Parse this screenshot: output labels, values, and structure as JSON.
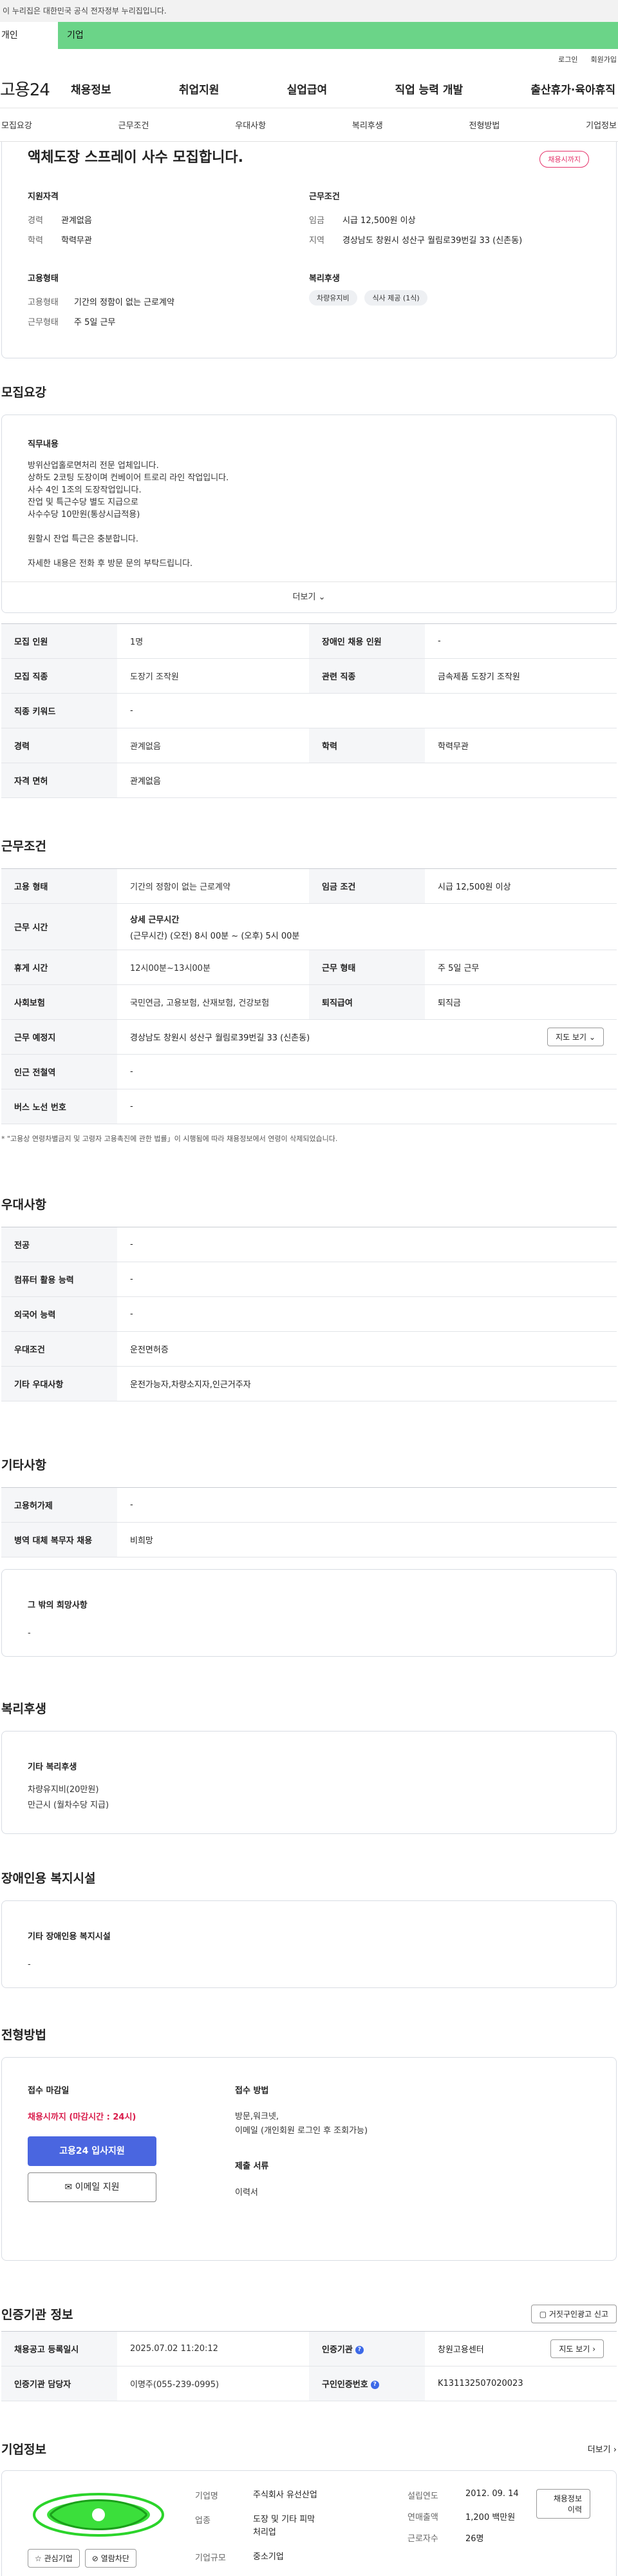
{
  "top": {
    "gov_banner": "이 누리집은 대한민국 공식 전자정부 누리집입니다.",
    "tab_personal": "개인",
    "tab_corporate": "기업"
  },
  "util": {
    "login": "로그인",
    "signup": "회원가입"
  },
  "gnb": {
    "logo": "고용24",
    "menu": [
      "채용정보",
      "취업지원",
      "실업급여",
      "직업 능력 개발",
      "출산휴가·육아휴직"
    ]
  },
  "anchor_nav": [
    "모집요강",
    "근무조건",
    "우대사항",
    "복리후생",
    "전형방법",
    "기업정보"
  ],
  "summary": {
    "title": "액체도장 스프레이 사수 모집합니다.",
    "badge": "채용시까지",
    "qual_header": "지원자격",
    "qual": [
      {
        "k": "경력",
        "v": "관계없음"
      },
      {
        "k": "학력",
        "v": "학력무관"
      }
    ],
    "work_header": "근무조건",
    "work": [
      {
        "k": "임금",
        "v": "시급 12,500원 이상"
      },
      {
        "k": "지역",
        "v": "경상남도 창원시 성산구 월림로39번길 33 (신촌동)"
      }
    ],
    "emp_header": "고용형태",
    "emp": [
      {
        "k": "고용형태",
        "v": "기간의 정함이 없는 근로계약"
      },
      {
        "k": "근무형태",
        "v": "주 5일 근무"
      }
    ],
    "welfare_header": "복리후생",
    "welfare_chips": [
      "차량유지비",
      "식사 제공 (1식)"
    ]
  },
  "recruit": {
    "section_title": "모집요강",
    "job_header": "직무내용",
    "job_lines": [
      "방위산업홀로면처리 전문 업체입니다.",
      "상하도 2코팅 도장이며 컨베이어 트로리 라인 작업입니다.",
      "사수 4인 1조의 도장작업입니다.",
      "잔업 및 특근수당 별도 지급으로",
      "사수수당 10만원(통상시급적용)",
      "",
      "원할시 잔업 특근은 충분합니다.",
      "",
      "자세한 내용은 전화 후 방문 문의 부탁드립니다."
    ],
    "more": "더보기",
    "table": [
      {
        "k1": "모집 인원",
        "v1": "1명",
        "k2": "장애인 채용 인원",
        "v2": "-"
      },
      {
        "k1": "모집 직종",
        "v1": "도장기 조작원",
        "k2": "관련 직종",
        "v2": "금속제품 도장기 조작원"
      },
      {
        "k1": "직종 키워드",
        "v1": "-"
      },
      {
        "k1": "경력",
        "v1": "관계없음",
        "k2": "학력",
        "v2": "학력무관"
      },
      {
        "k1": "자격 면허",
        "v1": "관계없음"
      }
    ]
  },
  "conditions": {
    "section_title": "근무조건",
    "emp_type_k": "고용 형태",
    "emp_type_v": "기간의 정함이 없는 근로계약",
    "wage_k": "임금 조건",
    "wage_v": "시급 12,500원 이상",
    "hours_k": "근무 시간",
    "hours_title": "상세 근무시간",
    "hours_v": "(근무시간) (오전) 8시 00분 ~ (오후) 5시 00분",
    "break_k": "휴게 시간",
    "break_v": "12시00분~13시00분",
    "worktype_k": "근무 형태",
    "worktype_v": "주 5일 근무",
    "insurance_k": "사회보험",
    "insurance_v": "국민연금, 고용보험, 산재보험, 건강보험",
    "severance_k": "퇴직급여",
    "severance_v": "퇴직금",
    "location_k": "근무 예정지",
    "location_v": "경상남도 창원시 성산구 월림로39번길 33 (신촌동)",
    "map_button": "지도 보기",
    "subway_k": "인근 전철역",
    "subway_v": "-",
    "bus_k": "버스 노선 번호",
    "bus_v": "-",
    "note": "* \"고용상 연령차별금지 및 고령자 고용촉진에 관한 법률」이 시행됨에 따라 채용정보에서 연령이 삭제되었습니다."
  },
  "preference": {
    "section_title": "우대사항",
    "rows": [
      {
        "k": "전공",
        "v": "-"
      },
      {
        "k": "컴퓨터 활용 능력",
        "v": "-"
      },
      {
        "k": "외국어 능력",
        "v": "-"
      },
      {
        "k": "우대조건",
        "v": "운전면허증"
      },
      {
        "k": "기타 우대사항",
        "v": "운전가능자,차량소지자,인근거주자"
      }
    ]
  },
  "etc": {
    "section_title": "기타사항",
    "rows": [
      {
        "k": "고용허가제",
        "v": "-"
      },
      {
        "k": "병역 대체 복무자 채용",
        "v": "비희망"
      }
    ],
    "other_header": "그 밖의 희망사항",
    "other_value": "-"
  },
  "welfare": {
    "section_title": "복리후생",
    "header": "기타 복리후생",
    "lines": [
      "차량유지비(20만원)",
      "만근시 (월차수당 지급)"
    ]
  },
  "disability": {
    "section_title": "장애인용 복지시설",
    "header": "기타 장애인용 복지시설",
    "value": "-"
  },
  "process": {
    "section_title": "전형방법",
    "deadline_header": "접수 마감일",
    "deadline": "채용시까지 (마감시간 : 24시)",
    "apply_button": "고용24 입사지원",
    "email_button": "이메일 지원",
    "method_header": "접수 방법",
    "method_lines": [
      "방문,워크넷,",
      "이메일 (개인회원 로그인 후 조회가능)"
    ],
    "docs_header": "제출 서류",
    "docs_value": "이력서"
  },
  "agency": {
    "section_title": "인증기관 정보",
    "report_button": "거짓구인광고 신고",
    "reg_date_k": "채용공고 등록일시",
    "reg_date_v": "2025.07.02 11:20:12",
    "agency_k": "인증기관",
    "agency_v": "창원고용센터",
    "map_button": "지도 보기",
    "manager_k": "인증기관 담당자",
    "manager_v": "이명주(055-239-0995)",
    "reqno_k": "구인인증번호",
    "reqno_v": "K131132507020023"
  },
  "company": {
    "section_title": "기업정보",
    "more": "더보기",
    "fav_button": "관심기업",
    "view_button": "열람차단",
    "name_k": "기업명",
    "name_v": "주식회사 유선산업",
    "industry_k": "업종",
    "industry_v": "도장 및 기타 피막 처리업",
    "size_k": "기업규모",
    "size_v": "중소기업",
    "founded_k": "설립연도",
    "founded_v": "2012. 09. 14",
    "sales_k": "연매출액",
    "sales_v": "1,200 백만원",
    "employees_k": "근로자수",
    "employees_v": "26명",
    "recruit_history_button": "채용정보 이력"
  }
}
